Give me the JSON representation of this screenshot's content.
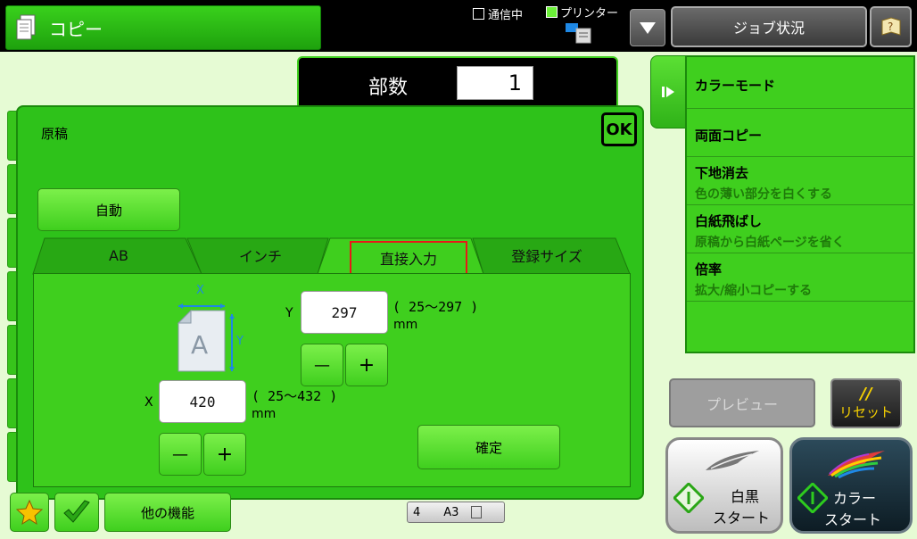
{
  "app": {
    "title": "コピー"
  },
  "status": {
    "comm": "通信中",
    "printer": "プリンター"
  },
  "header": {
    "job_status": "ジョブ状況"
  },
  "copies": {
    "label": "部数",
    "value": "1"
  },
  "dialog": {
    "title": "原稿",
    "ok": "OK",
    "auto": "自動",
    "tabs": [
      "AB",
      "インチ",
      "直接入力",
      "登録サイズ"
    ],
    "active_tab": "直接入力",
    "y_label": "Y",
    "y_value": "297",
    "y_range": "( 25～297 )",
    "x_label": "X",
    "x_value": "420",
    "x_range": "( 25～432 )",
    "unit": "mm",
    "diagram_x": "X",
    "diagram_y": "Y",
    "diagram_letter": "A",
    "minus": "—",
    "plus": "+",
    "confirm": "確定"
  },
  "sidebar": {
    "items": [
      {
        "title": "カラーモード",
        "sub": ""
      },
      {
        "title": "両面コピー",
        "sub": ""
      },
      {
        "title": "下地消去",
        "sub": "色の薄い部分を白くする"
      },
      {
        "title": "白紙飛ばし",
        "sub": "原稿から白紙ページを省く"
      },
      {
        "title": "倍率",
        "sub": "拡大/縮小コピーする"
      }
    ]
  },
  "buttons": {
    "preview": "プレビュー",
    "reset_mark": "//",
    "reset": "リセット",
    "bw_line1": "白黒",
    "bw_line2": "スタート",
    "color_line1": "カラー",
    "color_line2": "スタート",
    "other_functions": "他の機能"
  },
  "tray": {
    "number": "4",
    "size": "A3"
  },
  "colors": {
    "accent_green": "#3fcf1e",
    "highlight_red": "#e81818",
    "panel_green": "#2ec21a"
  }
}
